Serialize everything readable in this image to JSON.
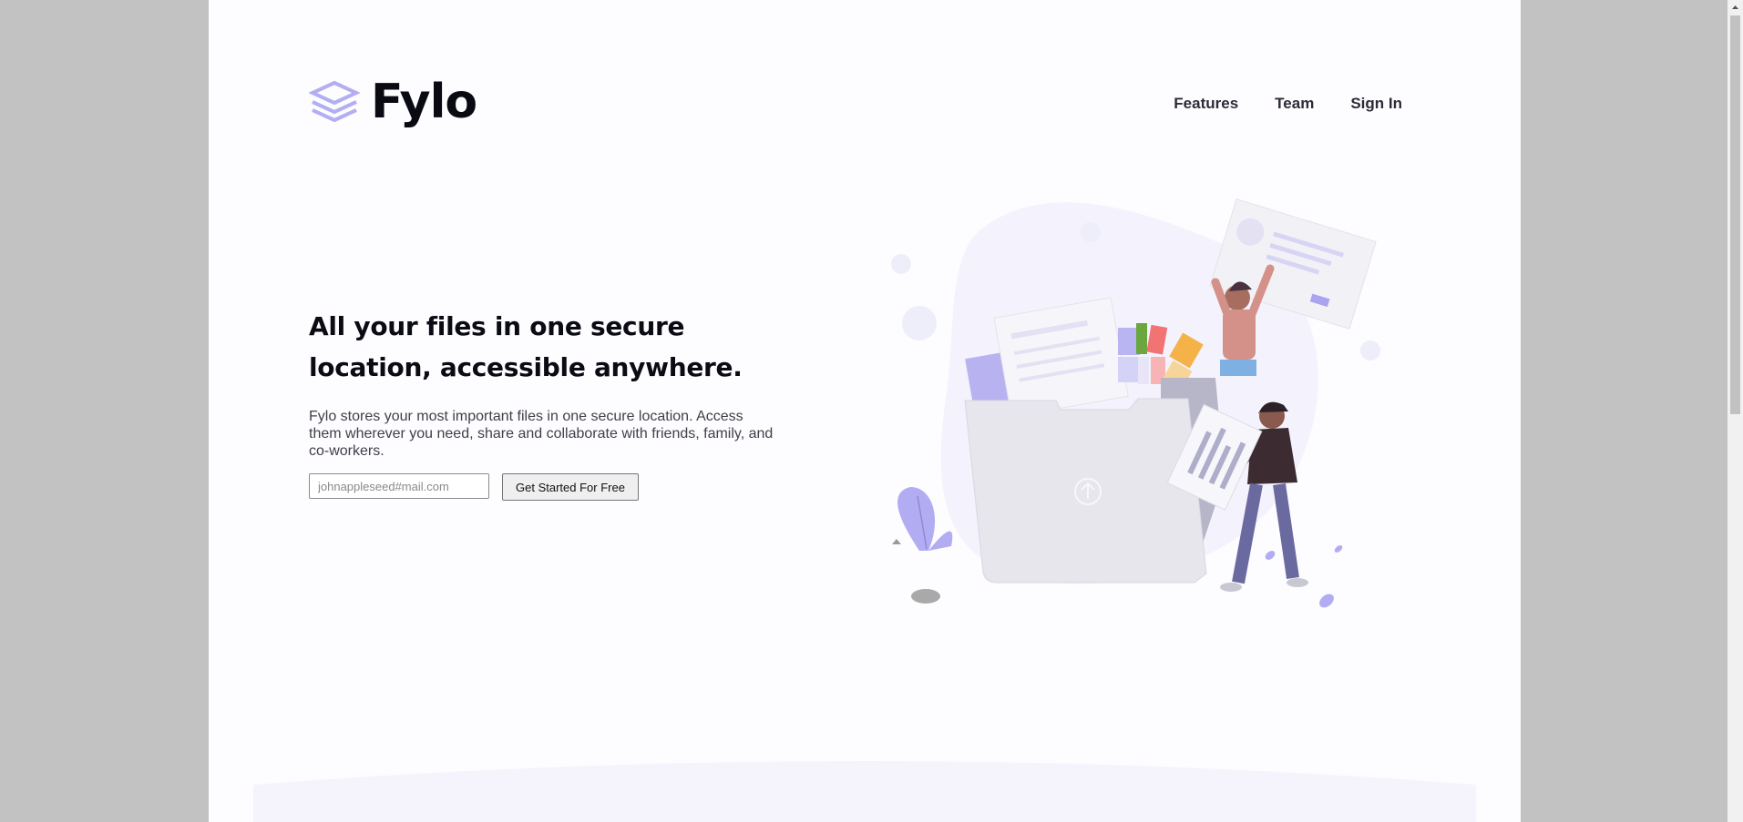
{
  "brand": {
    "name": "Fylo",
    "logo_icon": "stacked-layers-icon",
    "accent": "#aaa3f0"
  },
  "nav": {
    "features": "Features",
    "team": "Team",
    "sign_in": "Sign In"
  },
  "hero": {
    "title": "All your files in one secure location, accessible anywhere.",
    "description": "Fylo stores your most important files in one secure location. Access them wherever you need, share and collaborate with friends, family, and co-workers.",
    "email_placeholder": "johnappleseed#mail.com",
    "button_label": "Get Started For Free",
    "illustration_icon": "upload-icon"
  },
  "colors": {
    "page_bg": "#fdfcff",
    "outer_bg": "#c2c2c2",
    "heading": "#0b0b14",
    "body_text": "#404048"
  }
}
